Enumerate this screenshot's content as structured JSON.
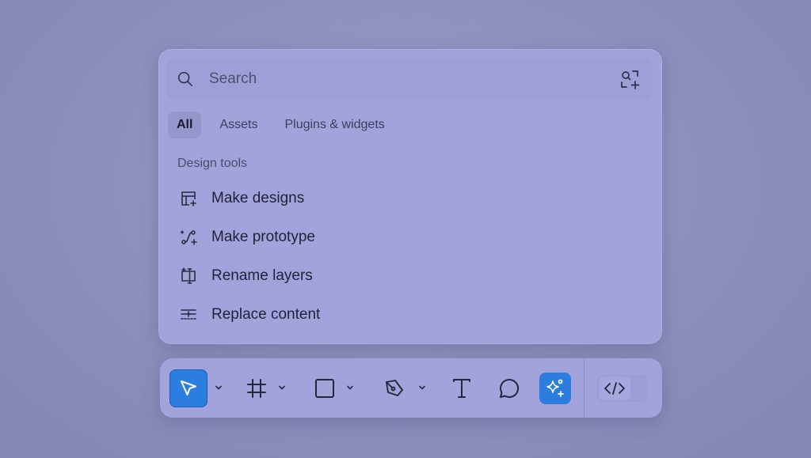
{
  "search": {
    "placeholder": "Search",
    "icon": "search-icon",
    "scan_icon": "scan-add-icon"
  },
  "tabs": [
    {
      "label": "All",
      "active": true
    },
    {
      "label": "Assets",
      "active": false
    },
    {
      "label": "Plugins & widgets",
      "active": false
    }
  ],
  "section": {
    "title": "Design tools"
  },
  "menu": [
    {
      "label": "Make designs",
      "icon": "make-designs-icon"
    },
    {
      "label": "Make prototype",
      "icon": "make-prototype-icon"
    },
    {
      "label": "Rename layers",
      "icon": "rename-layers-icon"
    },
    {
      "label": "Replace content",
      "icon": "replace-content-icon"
    }
  ],
  "toolbar": {
    "tools": [
      {
        "name": "move",
        "icon": "cursor-arrow-icon",
        "selected": true,
        "has_menu": true
      },
      {
        "name": "frame",
        "icon": "frame-hash-icon",
        "selected": false,
        "has_menu": true
      },
      {
        "name": "rectangle",
        "icon": "rectangle-icon",
        "selected": false,
        "has_menu": true
      },
      {
        "name": "pen",
        "icon": "pen-nib-icon",
        "selected": false,
        "has_menu": true
      },
      {
        "name": "text",
        "icon": "text-t-icon",
        "selected": false,
        "has_menu": false
      },
      {
        "name": "comment",
        "icon": "comment-bubble-icon",
        "selected": false,
        "has_menu": false
      },
      {
        "name": "actions",
        "icon": "ai-sparkle-icon",
        "selected": true,
        "has_menu": false
      }
    ],
    "dev_mode_icon": "code-brackets-icon"
  },
  "colors": {
    "accent": "#2b7de0",
    "panel": "#a3a3db",
    "background": "#8e8fbd",
    "text": "#22223a"
  }
}
